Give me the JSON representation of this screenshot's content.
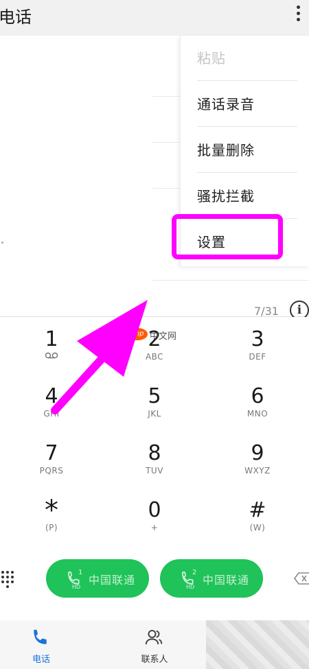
{
  "header": {
    "title": "电话"
  },
  "overflow_menu": {
    "items": [
      {
        "label": "粘贴",
        "enabled": false
      },
      {
        "label": "通话录音",
        "enabled": true
      },
      {
        "label": "批量删除",
        "enabled": true
      },
      {
        "label": "骚扰拦截",
        "enabled": true
      },
      {
        "label": "设置",
        "enabled": true,
        "highlighted": true
      }
    ]
  },
  "counter": {
    "text": "7/31"
  },
  "info": {
    "glyph": "i"
  },
  "keypad": {
    "keys": [
      {
        "digit": "1",
        "sub": ""
      },
      {
        "digit": "2",
        "sub": "ABC"
      },
      {
        "digit": "3",
        "sub": "DEF"
      },
      {
        "digit": "4",
        "sub": "GHI"
      },
      {
        "digit": "5",
        "sub": "JKL"
      },
      {
        "digit": "6",
        "sub": "MNO"
      },
      {
        "digit": "7",
        "sub": "PQRS"
      },
      {
        "digit": "8",
        "sub": "TUV"
      },
      {
        "digit": "9",
        "sub": "WXYZ"
      },
      {
        "digit": "*",
        "sub": "(P)"
      },
      {
        "digit": "0",
        "sub": "+"
      },
      {
        "digit": "#",
        "sub": "(W)"
      }
    ]
  },
  "call_buttons": [
    {
      "sim": "1",
      "hd": "HD",
      "carrier": "中国联通"
    },
    {
      "sim": "2",
      "hd": "HD",
      "carrier": "中国联通"
    }
  ],
  "bottom_nav": {
    "items": [
      {
        "label": "电话",
        "active": true,
        "icon": "phone-icon"
      },
      {
        "label": "联系人",
        "active": false,
        "icon": "contacts-icon"
      }
    ]
  },
  "watermark": {
    "logo": "php",
    "text": "中文网"
  },
  "colors": {
    "accent_green": "#1fc359",
    "active_blue": "#1a73d9",
    "annotation_magenta": "#ff00ff"
  }
}
